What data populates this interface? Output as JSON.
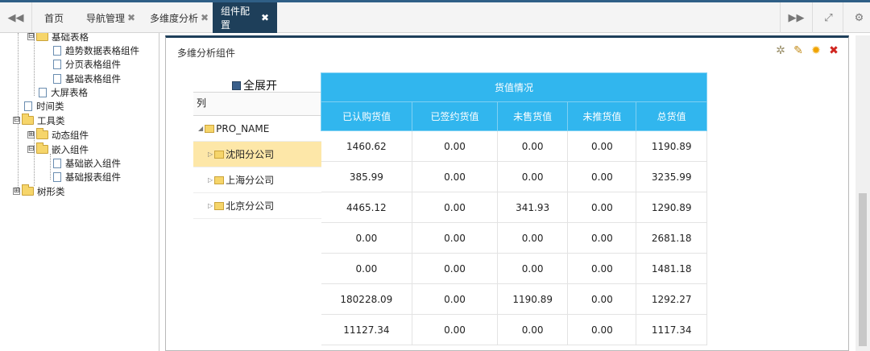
{
  "tabs": {
    "items": [
      {
        "label": "首页",
        "closable": false
      },
      {
        "label": "导航管理",
        "closable": true
      },
      {
        "label": "多维度分析",
        "closable": true
      },
      {
        "label": "组件配置",
        "closable": true,
        "active": true
      }
    ],
    "close_glyph": "✖"
  },
  "tree": {
    "nodes": [
      {
        "label": "基础表格",
        "type": "folder",
        "toggle": "⊟"
      },
      {
        "label": "趋势数据表格组件",
        "type": "doc"
      },
      {
        "label": "分页表格组件",
        "type": "doc"
      },
      {
        "label": "基础表格组件",
        "type": "doc"
      },
      {
        "label": "大屏表格",
        "type": "doc"
      },
      {
        "label": "时间类",
        "type": "doc"
      },
      {
        "label": "工具类",
        "type": "folder",
        "toggle": "⊟"
      },
      {
        "label": "动态组件",
        "type": "folder",
        "toggle": "⊞"
      },
      {
        "label": "嵌入组件",
        "type": "folder",
        "toggle": "⊟"
      },
      {
        "label": "基础嵌入组件",
        "type": "doc"
      },
      {
        "label": "基础报表组件",
        "type": "doc"
      },
      {
        "label": "树形类",
        "type": "folder",
        "toggle": "⊞"
      }
    ]
  },
  "panel": {
    "title": "多维分析组件",
    "tools": [
      {
        "icon": "gear-icon",
        "glyph": "✲",
        "color": "#9a8f6a"
      },
      {
        "icon": "edit-icon",
        "glyph": "✎",
        "color": "#c28a18"
      },
      {
        "icon": "settings-icon",
        "glyph": "✹",
        "color": "#f0a400"
      },
      {
        "icon": "close-icon",
        "glyph": "✖",
        "color": "#d0251f"
      }
    ]
  },
  "row_tree": {
    "expand_all": "全展开",
    "column_header": "列",
    "root": "PRO_NAME",
    "rows": [
      "沈阳分公司",
      "上海分公司",
      "北京分公司"
    ]
  },
  "table": {
    "group_header": "货值情况",
    "columns": [
      "已认购货值",
      "已签约货值",
      "未售货值",
      "未推货值",
      "总货值"
    ],
    "rows": [
      [
        "1460.62",
        "0.00",
        "0.00",
        "0.00",
        "1190.89"
      ],
      [
        "385.99",
        "0.00",
        "0.00",
        "0.00",
        "3235.99"
      ],
      [
        "4465.12",
        "0.00",
        "341.93",
        "0.00",
        "1290.89"
      ],
      [
        "0.00",
        "0.00",
        "0.00",
        "0.00",
        "2681.18"
      ],
      [
        "0.00",
        "0.00",
        "0.00",
        "0.00",
        "1481.18"
      ],
      [
        "180228.09",
        "0.00",
        "1190.89",
        "0.00",
        "1292.27"
      ],
      [
        "11127.34",
        "0.00",
        "0.00",
        "0.00",
        "1117.34"
      ]
    ]
  },
  "colors": {
    "header_blue": "#31b6ee",
    "active_tab": "#1e3f5a",
    "selected_row": "#fde7a8"
  }
}
